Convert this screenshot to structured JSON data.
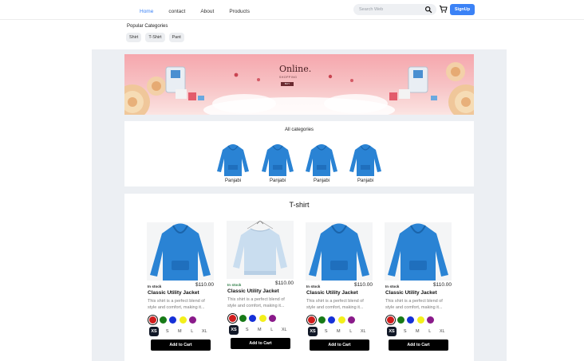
{
  "nav": {
    "links": [
      "Home",
      "contact",
      "About",
      "Products"
    ],
    "active": "Home",
    "search_placeholder": "Search Web",
    "signup_label": "SignUp"
  },
  "popular": {
    "title": "Popular Categories",
    "chips": [
      "Shirt",
      "T-Shirt",
      "Pant"
    ]
  },
  "banner": {
    "title": "Online.",
    "subtitle": "SHOPPING",
    "button": "BUY"
  },
  "categories": {
    "title": "All categories",
    "items": [
      {
        "label": "Panjabi",
        "color": "#2a83d4"
      },
      {
        "label": "Panjabi",
        "color": "#2a83d4"
      },
      {
        "label": "Panjabi",
        "color": "#2a83d4"
      },
      {
        "label": "Panjabi",
        "color": "#2a83d4"
      }
    ]
  },
  "tshirt_section": {
    "title": "T-shirt",
    "products": [
      {
        "stock": "In stock",
        "price": "$110.00",
        "name": "Classic Utility Jacket",
        "desc": "This shirt is a perfect blend of style and comfort, making it...",
        "image": "blue-hoodie",
        "colors": [
          "#d01c1c",
          "#177a17",
          "#1530d8",
          "#f3ef1a",
          "#8a1a8a"
        ],
        "selected_color": 0,
        "sizes": [
          "XS",
          "S",
          "M",
          "L",
          "XL"
        ],
        "selected_size": "XS",
        "button": "Add to Cart"
      },
      {
        "stock": "In stock",
        "price": "$110.00",
        "name": "Classic Utility Jacket",
        "desc": "This shirt is a perfect blend of style and comfort, making it...",
        "image": "light-blue-sweatshirt",
        "colors": [
          "#d01c1c",
          "#177a17",
          "#1530d8",
          "#f3ef1a",
          "#8a1a8a"
        ],
        "selected_color": 0,
        "sizes": [
          "XS",
          "S",
          "M",
          "L",
          "XL"
        ],
        "selected_size": "XS",
        "button": "Add to Cart"
      },
      {
        "stock": "In stock",
        "price": "$110.00",
        "name": "Classic Utility Jacket",
        "desc": "This shirt is a perfect blend of style and comfort, making it...",
        "image": "blue-hoodie",
        "colors": [
          "#d01c1c",
          "#177a17",
          "#1530d8",
          "#f3ef1a",
          "#8a1a8a"
        ],
        "selected_color": 0,
        "sizes": [
          "XS",
          "S",
          "M",
          "L",
          "XL"
        ],
        "selected_size": "XS",
        "button": "Add to Cart"
      },
      {
        "stock": "In stock",
        "price": "$110.00",
        "name": "Classic Utility Jacket",
        "desc": "This shirt is a perfect blend of style and comfort, making it...",
        "image": "blue-hoodie",
        "colors": [
          "#d01c1c",
          "#177a17",
          "#1530d8",
          "#f3ef1a",
          "#8a1a8a"
        ],
        "selected_color": 0,
        "sizes": [
          "XS",
          "S",
          "M",
          "L",
          "XL"
        ],
        "selected_size": "XS",
        "button": "Add to Cart"
      }
    ]
  },
  "colors": {
    "accent": "#3b82f6",
    "hoodie_blue": "#2a83d4",
    "page_gray": "#eceff3"
  }
}
